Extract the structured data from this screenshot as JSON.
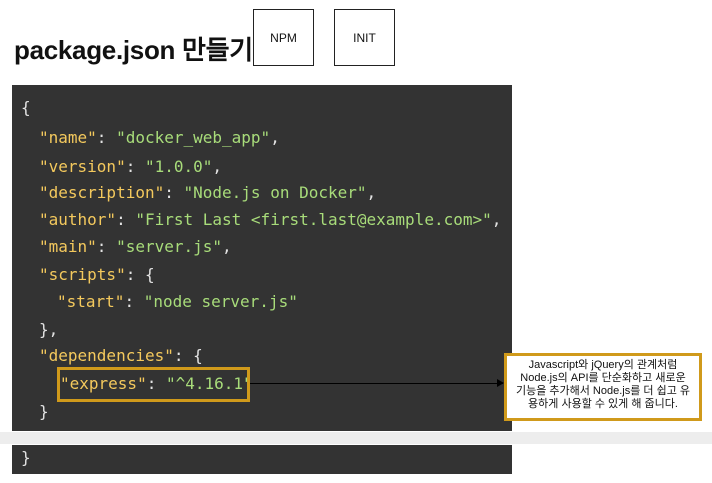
{
  "title": "package.json 만들기",
  "tags": {
    "npm": "NPM",
    "init": "INIT"
  },
  "code": {
    "open_brace": "{",
    "name_key": "\"name\"",
    "name_val": "\"docker_web_app\"",
    "version_key": "\"version\"",
    "version_val": "\"1.0.0\"",
    "description_key": "\"description\"",
    "description_val": "\"Node.js on Docker\"",
    "author_key": "\"author\"",
    "author_val": "\"First Last <first.last@example.com>\"",
    "main_key": "\"main\"",
    "main_val": "\"server.js\"",
    "scripts_key": "\"scripts\"",
    "start_key": "\"start\"",
    "start_val": "\"node server.js\"",
    "scripts_close": "},",
    "dependencies_key": "\"dependencies\"",
    "express_key": "\"express\"",
    "express_val": "\"^4.16.1\"",
    "dependencies_close": "}",
    "close_brace": "}"
  },
  "callout": {
    "lines": [
      "Javascript와 jQuery의 관계처럼",
      "Node.js의 API를 단순화하고 새로운",
      "기능을 추가해서 Node.js를 더 쉽고 유",
      "용하게 사용할 수 있게 해 줍니다."
    ]
  },
  "colors": {
    "code_background": "#333333",
    "json_key": "#f4c95d",
    "json_string": "#a8dc7a",
    "highlight_border": "#d09a1b"
  }
}
